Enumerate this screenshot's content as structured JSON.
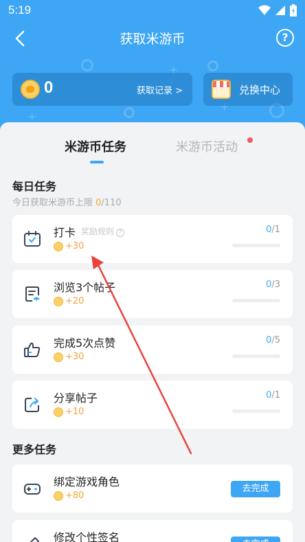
{
  "status_bar": {
    "time": "5:19"
  },
  "nav": {
    "title": "获取米游币",
    "help_label": "?"
  },
  "balance": {
    "value": "0",
    "record_link": "获取记录 >"
  },
  "exchange": {
    "label": "兑换中心"
  },
  "tabs": [
    {
      "label": "米游币任务",
      "active": true
    },
    {
      "label": "米游币活动",
      "active": false,
      "has_dot": true
    }
  ],
  "daily": {
    "title": "每日任务",
    "limit_prefix": "今日获取米游币上限 ",
    "limit_current": "0",
    "limit_max": "/110",
    "tasks": [
      {
        "name": "打卡",
        "rule": "奖励规则",
        "reward": "+30",
        "done": "0",
        "total": "/1",
        "progress": 0,
        "icon": "calendar-check-icon"
      },
      {
        "name": "浏览3个帖子",
        "reward": "+20",
        "done": "0",
        "total": "/3",
        "progress": 0,
        "icon": "document-icon"
      },
      {
        "name": "完成5次点赞",
        "reward": "+30",
        "done": "0",
        "total": "/5",
        "progress": 0,
        "icon": "thumbs-up-icon"
      },
      {
        "name": "分享帖子",
        "reward": "+10",
        "done": "0",
        "total": "/1",
        "progress": 0,
        "icon": "share-icon"
      }
    ]
  },
  "more": {
    "title": "更多任务",
    "tasks": [
      {
        "name": "绑定游戏角色",
        "reward": "+80",
        "button": "去完成",
        "icon": "gamepad-icon"
      },
      {
        "name": "修改个性签名",
        "button": "去完成",
        "icon": "pencil-icon"
      }
    ]
  },
  "colors": {
    "primary": "#3da6f5",
    "reward": "#f0a43a",
    "annotation_arrow": "#e8433a"
  }
}
